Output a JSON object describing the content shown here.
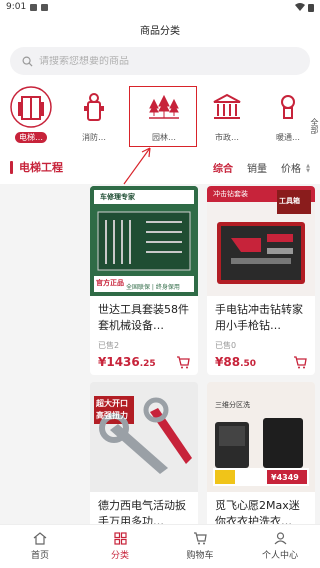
{
  "status": {
    "time": "9:01"
  },
  "header": {
    "title": "商品分类"
  },
  "search": {
    "placeholder": "请搜索您想要的商品"
  },
  "categories": [
    {
      "label": "电梯…",
      "icon": "elevator-icon",
      "active": true
    },
    {
      "label": "消防…",
      "icon": "fire-hydrant-icon",
      "active": false
    },
    {
      "label": "园林…",
      "icon": "trees-icon",
      "active": false
    },
    {
      "label": "市政…",
      "icon": "civic-building-icon",
      "active": false
    },
    {
      "label": "暖通…",
      "icon": "hvac-icon",
      "active": false
    }
  ],
  "more": {
    "label": "全部"
  },
  "subcategory": {
    "title": "电梯工程"
  },
  "sorts": {
    "comprehensive": "综合",
    "sales": "销量",
    "price": "价格"
  },
  "products": [
    {
      "name": "世达工具套装58件套机械设备…",
      "sold": "已售2",
      "price_int": "¥1436",
      "price_dec": ".25",
      "img_text_top": "车修理专家",
      "img_text_bar": "全国联保 | 终身保用",
      "img_text_badge": "官方正品"
    },
    {
      "name": "手电钻冲击钻转家用小手枪钻…",
      "sold": "已售0",
      "price_int": "¥88",
      "price_dec": ".50",
      "img_text_top": "冲击钻套装",
      "img_text_badge": "工具箱"
    },
    {
      "name": "德力西电气活动扳手万用多功…",
      "sold": "",
      "price_int": "",
      "price_dec": "",
      "img_text_top": "超大开口",
      "img_text_badge": "高强扭力"
    },
    {
      "name": "觅飞心愿2Max迷你衣衣护洗衣…",
      "sold": "",
      "price_int": "",
      "price_dec": "",
      "img_text_top": "三维分区洗",
      "img_text_badge": "¥4349"
    }
  ],
  "tabbar": [
    {
      "label": "首页",
      "icon": "home-icon",
      "active": false
    },
    {
      "label": "分类",
      "icon": "category-icon",
      "active": true
    },
    {
      "label": "购物车",
      "icon": "cart-icon",
      "active": false
    },
    {
      "label": "个人中心",
      "icon": "user-icon",
      "active": false
    }
  ],
  "colors": {
    "accent": "#c7233a"
  }
}
